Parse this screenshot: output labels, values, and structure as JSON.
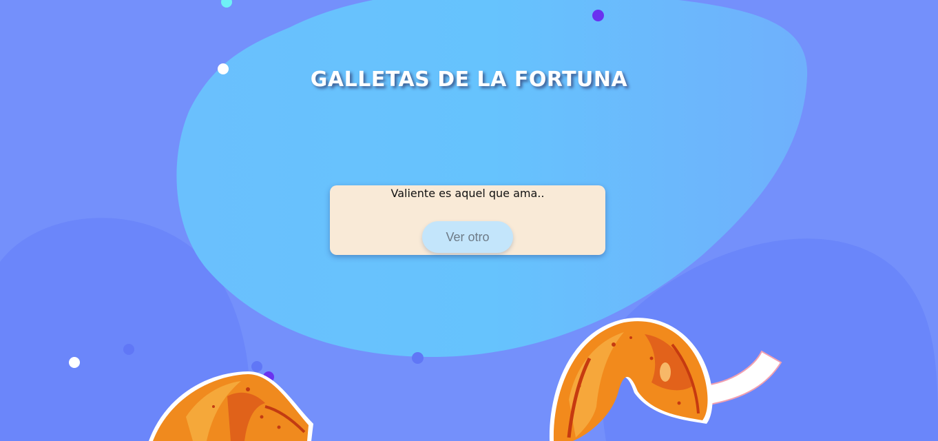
{
  "page": {
    "title": "GALLETAS DE LA FORTUNA"
  },
  "fortune": {
    "text": "Valiente es aquel que ama.."
  },
  "actions": {
    "next_label": "Ver otro"
  },
  "colors": {
    "background": "#7490fb",
    "blob_center": "#66c3fd",
    "card_background": "#f9ead7",
    "button_background": "#c3e5fb",
    "button_text": "#6d7a86"
  },
  "icons": {
    "cookie": "fortune-cookie-icon",
    "dot": "bubble-dot"
  }
}
